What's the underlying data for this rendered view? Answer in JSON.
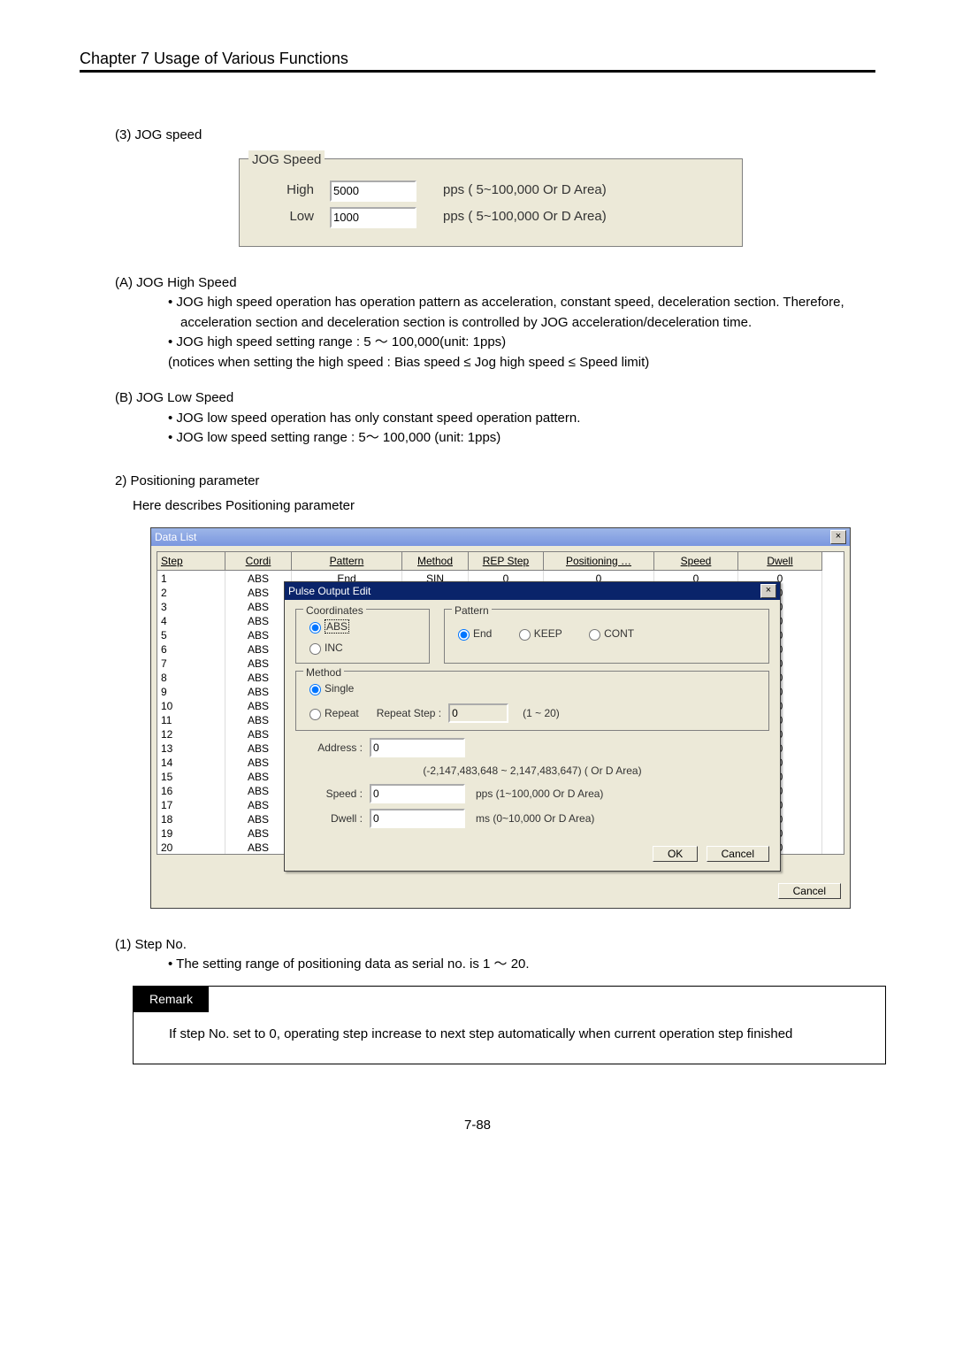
{
  "header": {
    "chapter": "Chapter 7   Usage of Various Functions"
  },
  "s3": {
    "title": "(3) JOG speed",
    "box_legend": "JOG Speed",
    "high_label": "High",
    "low_label": "Low",
    "high_value": "5000",
    "low_value": "1000",
    "unit": "pps ( 5~100,000 Or D Area)"
  },
  "a": {
    "title": "(A) JOG High Speed",
    "b1": "JOG high speed operation has operation pattern as acceleration, constant speed, deceleration section. Therefore, acceleration section and deceleration section is controlled by JOG acceleration/deceleration time.",
    "b2": "JOG high speed setting range : 5  ～  100,000(unit: 1pps)",
    "b2_note": "(notices when setting the high speed : Bias speed  ≤  Jog high speed  ≤  Speed limit)"
  },
  "b": {
    "title": "(B) JOG Low Speed",
    "b1": "JOG low speed operation has only constant speed operation pattern.",
    "b2": "JOG low speed setting range : 5～  100,000 (unit: 1pps)"
  },
  "s2": {
    "title": "2) Positioning parameter",
    "desc": "Here describes Positioning parameter"
  },
  "grid_window": {
    "title": "Data List",
    "close": "×",
    "headers": {
      "step": "Step",
      "cordi": "Cordi",
      "pattern": "Pattern",
      "method": "Method",
      "rep": "REP Step",
      "pos": "Positioning …",
      "speed": "Speed",
      "dwell": "Dwell"
    },
    "rows": [
      {
        "step": "1",
        "cordi": "ABS",
        "pattern": "End",
        "method": "SIN",
        "rep": "0",
        "pos": "0",
        "speed": "0",
        "dwell": "0"
      },
      {
        "step": "2",
        "cordi": "ABS",
        "pattern": "",
        "method": "",
        "rep": "",
        "pos": "",
        "speed": "",
        "dwell": "0"
      },
      {
        "step": "3",
        "cordi": "ABS",
        "pattern": "",
        "method": "",
        "rep": "",
        "pos": "",
        "speed": "",
        "dwell": "0"
      },
      {
        "step": "4",
        "cordi": "ABS",
        "pattern": "",
        "method": "",
        "rep": "",
        "pos": "",
        "speed": "",
        "dwell": "0"
      },
      {
        "step": "5",
        "cordi": "ABS",
        "pattern": "",
        "method": "",
        "rep": "",
        "pos": "",
        "speed": "",
        "dwell": "0"
      },
      {
        "step": "6",
        "cordi": "ABS",
        "pattern": "",
        "method": "",
        "rep": "",
        "pos": "",
        "speed": "",
        "dwell": "0"
      },
      {
        "step": "7",
        "cordi": "ABS",
        "pattern": "",
        "method": "",
        "rep": "",
        "pos": "",
        "speed": "",
        "dwell": "0"
      },
      {
        "step": "8",
        "cordi": "ABS",
        "pattern": "",
        "method": "",
        "rep": "",
        "pos": "",
        "speed": "",
        "dwell": "0"
      },
      {
        "step": "9",
        "cordi": "ABS",
        "pattern": "",
        "method": "",
        "rep": "",
        "pos": "",
        "speed": "",
        "dwell": "0"
      },
      {
        "step": "10",
        "cordi": "ABS",
        "pattern": "",
        "method": "",
        "rep": "",
        "pos": "",
        "speed": "",
        "dwell": "0"
      },
      {
        "step": "11",
        "cordi": "ABS",
        "pattern": "",
        "method": "",
        "rep": "",
        "pos": "",
        "speed": "",
        "dwell": "0"
      },
      {
        "step": "12",
        "cordi": "ABS",
        "pattern": "",
        "method": "",
        "rep": "",
        "pos": "",
        "speed": "",
        "dwell": "0"
      },
      {
        "step": "13",
        "cordi": "ABS",
        "pattern": "",
        "method": "",
        "rep": "",
        "pos": "",
        "speed": "",
        "dwell": "0"
      },
      {
        "step": "14",
        "cordi": "ABS",
        "pattern": "",
        "method": "",
        "rep": "",
        "pos": "",
        "speed": "",
        "dwell": "0"
      },
      {
        "step": "15",
        "cordi": "ABS",
        "pattern": "",
        "method": "",
        "rep": "",
        "pos": "",
        "speed": "",
        "dwell": "0"
      },
      {
        "step": "16",
        "cordi": "ABS",
        "pattern": "",
        "method": "",
        "rep": "",
        "pos": "",
        "speed": "",
        "dwell": "0"
      },
      {
        "step": "17",
        "cordi": "ABS",
        "pattern": "",
        "method": "",
        "rep": "",
        "pos": "",
        "speed": "",
        "dwell": "0"
      },
      {
        "step": "18",
        "cordi": "ABS",
        "pattern": "",
        "method": "",
        "rep": "",
        "pos": "",
        "speed": "",
        "dwell": "0"
      },
      {
        "step": "19",
        "cordi": "ABS",
        "pattern": "",
        "method": "",
        "rep": "",
        "pos": "",
        "speed": "",
        "dwell": "0"
      },
      {
        "step": "20",
        "cordi": "ABS",
        "pattern": "",
        "method": "",
        "rep": "",
        "pos": "",
        "speed": "",
        "dwell": "0"
      }
    ],
    "outer_cancel": "Cancel"
  },
  "dlg": {
    "title": "Pulse Output Edit",
    "close": "×",
    "coord_legend": "Coordinates",
    "coord_abs": "ABS",
    "coord_inc": "INC",
    "pattern_legend": "Pattern",
    "pattern_end": "End",
    "pattern_keep": "KEEP",
    "pattern_cont": "CONT",
    "method_legend": "Method",
    "method_single": "Single",
    "method_repeat": "Repeat",
    "repeat_step_label": "Repeat Step :",
    "repeat_step_value": "0",
    "repeat_step_hint": "(1 ~ 20)",
    "address_label": "Address :",
    "address_value": "0",
    "address_hint": "(-2,147,483,648 ~ 2,147,483,647) ( Or D Area)",
    "speed_label": "Speed :",
    "speed_value": "0",
    "speed_hint": "pps (1~100,000 Or D Area)",
    "dwell_label": "Dwell :",
    "dwell_value": "0",
    "dwell_hint": "ms (0~10,000 Or D Area)",
    "ok": "OK",
    "cancel": "Cancel"
  },
  "stepno": {
    "title": "(1) Step No.",
    "b1": "The setting range of positioning data as serial no. is 1  ～  20."
  },
  "remark": {
    "tab": "Remark",
    "text": "If step No. set to 0, operating step increase to next step automatically when current operation step finished"
  },
  "footer": {
    "page": "7-88"
  }
}
